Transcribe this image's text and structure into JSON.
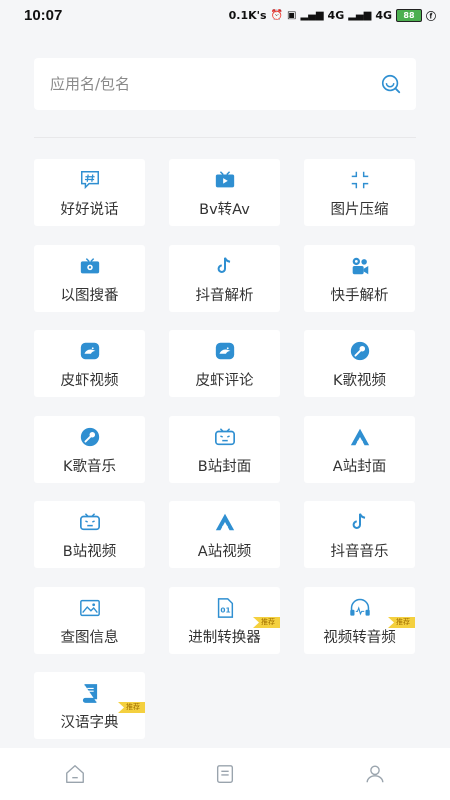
{
  "status_bar": {
    "time": "10:07",
    "speed": "0.1K's",
    "net1": "4G",
    "net2": "4G",
    "battery": "88"
  },
  "search": {
    "placeholder": "应用名/包名"
  },
  "colors": {
    "accent": "#2f8fd1",
    "badge": "#f4d03f"
  },
  "tools": [
    {
      "label": "好好说话",
      "icon": "hashtag-chat-icon"
    },
    {
      "label": "Bv转Av",
      "icon": "tv-play-icon"
    },
    {
      "label": "图片压缩",
      "icon": "compress-icon"
    },
    {
      "label": "以图搜番",
      "icon": "image-search-tv-icon"
    },
    {
      "label": "抖音解析",
      "icon": "tiktok-note-icon"
    },
    {
      "label": "快手解析",
      "icon": "kuaishou-camera-icon"
    },
    {
      "label": "皮虾视频",
      "icon": "pipixia-icon"
    },
    {
      "label": "皮虾评论",
      "icon": "pipixia-comment-icon"
    },
    {
      "label": "K歌视频",
      "icon": "karaoke-mic-icon"
    },
    {
      "label": "K歌音乐",
      "icon": "karaoke-music-icon"
    },
    {
      "label": "B站封面",
      "icon": "bilibili-cover-icon"
    },
    {
      "label": "A站封面",
      "icon": "acfun-cover-icon"
    },
    {
      "label": "B站视频",
      "icon": "bilibili-video-icon"
    },
    {
      "label": "A站视频",
      "icon": "acfun-video-icon"
    },
    {
      "label": "抖音音乐",
      "icon": "tiktok-music-icon"
    },
    {
      "label": "查图信息",
      "icon": "image-info-icon"
    },
    {
      "label": "进制转换器",
      "icon": "binary-file-icon",
      "badge": "推荐"
    },
    {
      "label": "视频转音频",
      "icon": "headphones-icon",
      "badge": "推荐"
    },
    {
      "label": "汉语字典",
      "icon": "dictionary-book-icon",
      "badge": "推荐"
    }
  ],
  "bottom_nav": [
    {
      "icon": "home-icon"
    },
    {
      "icon": "notes-icon"
    },
    {
      "icon": "user-icon"
    }
  ]
}
